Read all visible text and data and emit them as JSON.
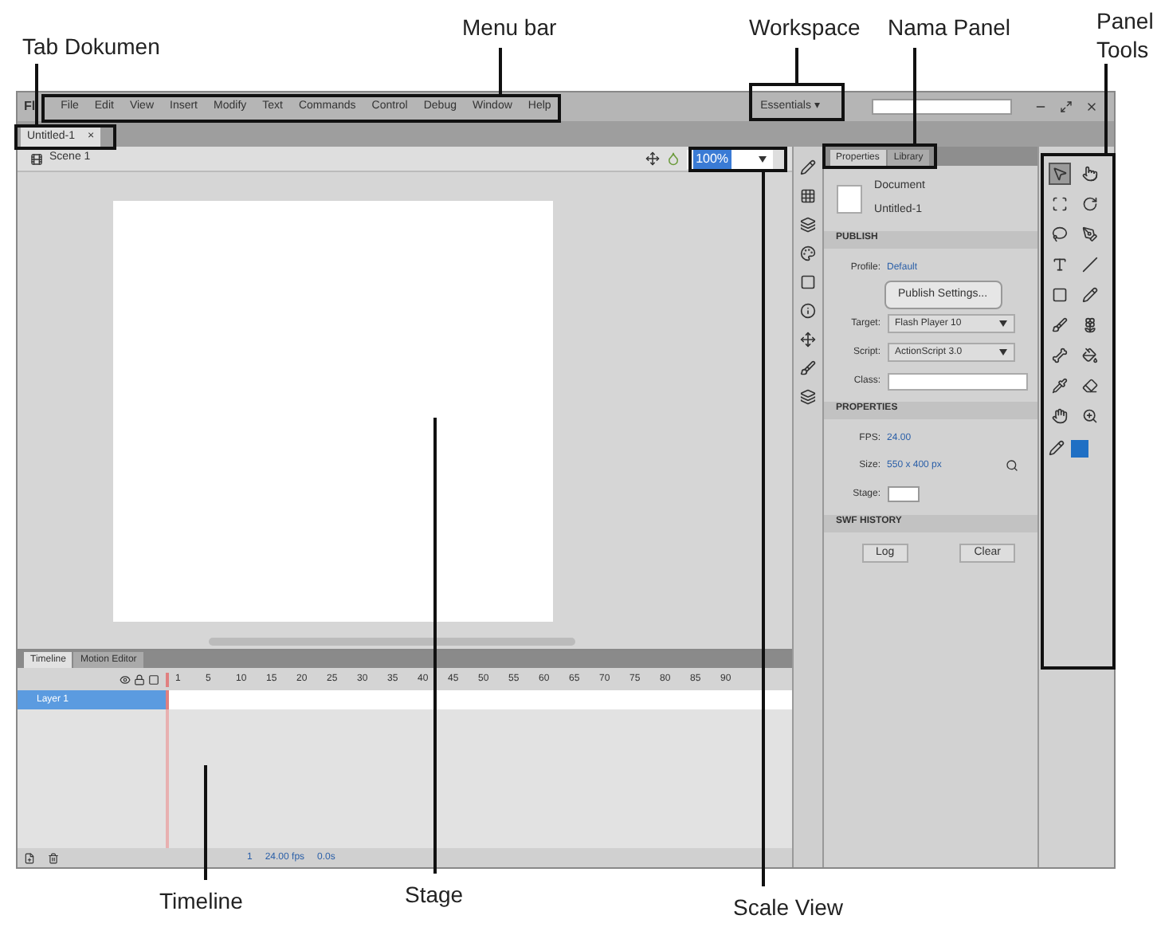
{
  "labels": [
    {
      "text": "Tab Dokumen"
    },
    {
      "text": "Menu bar"
    },
    {
      "text": "Workspace"
    },
    {
      "text": "Nama Panel"
    },
    {
      "text": "Panel Tools"
    },
    {
      "text": "Timeline"
    },
    {
      "text": "Stage"
    },
    {
      "text": "Scale View"
    }
  ],
  "app": {
    "logo": "Fl",
    "menu": [
      "File",
      "Edit",
      "View",
      "Insert",
      "Modify",
      "Text",
      "Commands",
      "Control",
      "Debug",
      "Window",
      "Help"
    ],
    "workspace": "Essentials ▾"
  },
  "document_tabs": [
    {
      "label": "Untitled-1",
      "selected": true,
      "close": "×"
    }
  ],
  "scene": "Scene 1",
  "zoom": "100%",
  "properties_panel": {
    "tabs": [
      {
        "label": "Properties",
        "selected": true
      },
      {
        "label": "Library",
        "selected": false
      }
    ],
    "doc_type": "Document",
    "doc_name": "Untitled-1",
    "sections": [
      {
        "title": "PUBLISH",
        "rows": [
          {
            "kind": "text",
            "label": "Profile:",
            "value": "Default"
          },
          {
            "kind": "button",
            "value": "Publish Settings..."
          },
          {
            "kind": "select",
            "label": "Target:",
            "value": "Flash Player 10"
          },
          {
            "kind": "select",
            "label": "Script:",
            "value": "ActionScript 3.0"
          },
          {
            "kind": "field",
            "label": "Class:"
          }
        ]
      },
      {
        "title": "PROPERTIES",
        "rows": [
          {
            "kind": "text",
            "label": "FPS:",
            "value": "24.00"
          },
          {
            "kind": "size",
            "label": "Size:",
            "value": "550 x 400 px"
          },
          {
            "kind": "swatch",
            "label": "Stage:"
          }
        ]
      },
      {
        "title": "SWF HISTORY",
        "rows": [
          {
            "kind": "buttons",
            "values": [
              "Log",
              "Clear"
            ]
          }
        ]
      }
    ]
  },
  "tools": [
    {
      "kind": "select",
      "selected": true
    },
    {
      "kind": "subselect",
      "selected": false
    },
    {
      "kind": "transform",
      "selected": false
    },
    {
      "kind": "rotate",
      "selected": false
    },
    {
      "kind": "lasso",
      "selected": false
    },
    {
      "kind": "pen",
      "selected": false
    },
    {
      "kind": "text",
      "selected": false
    },
    {
      "kind": "line",
      "selected": false
    },
    {
      "kind": "rect",
      "selected": false
    },
    {
      "kind": "pencil",
      "selected": false
    },
    {
      "kind": "brush",
      "selected": false
    },
    {
      "kind": "deco",
      "selected": false
    },
    {
      "kind": "bone",
      "selected": false
    },
    {
      "kind": "bucket",
      "selected": false
    },
    {
      "kind": "eyedropper",
      "selected": false
    },
    {
      "kind": "eraser",
      "selected": false
    },
    {
      "kind": "hand",
      "selected": false
    },
    {
      "kind": "zoom",
      "selected": false
    }
  ],
  "timeline": {
    "tabs": [
      {
        "label": "Timeline",
        "selected": true
      },
      {
        "label": "Motion Editor",
        "selected": false
      }
    ],
    "frames": [
      "1",
      "5",
      "10",
      "15",
      "20",
      "25",
      "30",
      "35",
      "40",
      "45",
      "50",
      "55",
      "60",
      "65",
      "70",
      "75",
      "80",
      "85",
      "90"
    ],
    "layers": [
      {
        "name": "Layer 1",
        "selected": true
      }
    ],
    "status": [
      "1",
      "24.00 fps",
      "0.0s"
    ]
  }
}
